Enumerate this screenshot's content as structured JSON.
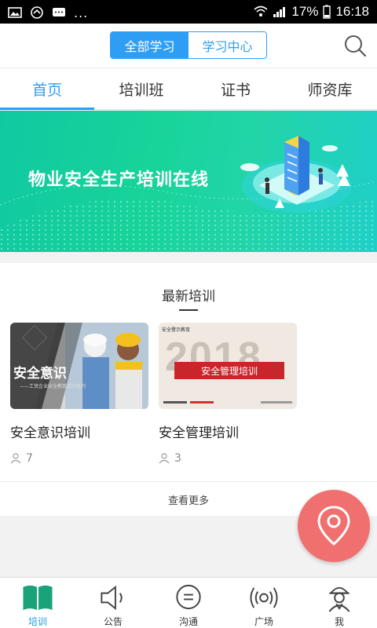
{
  "status_bar": {
    "more": "...",
    "battery_pct": "17%",
    "time": "16:18"
  },
  "header": {
    "segments": [
      {
        "label": "全部学习",
        "active": true
      },
      {
        "label": "学习中心",
        "active": false
      }
    ],
    "search_icon": "search-icon"
  },
  "tabs": [
    {
      "label": "首页",
      "active": true
    },
    {
      "label": "培训班",
      "active": false
    },
    {
      "label": "证书",
      "active": false
    },
    {
      "label": "师资库",
      "active": false
    }
  ],
  "banner": {
    "title": "物业安全生产培训在线",
    "accent": "#18d39a"
  },
  "latest": {
    "title": "最新培训",
    "cards": [
      {
        "title": "安全意识培训",
        "count": "7",
        "image_overlay": "安全意识",
        "image_caption": "——工贸企业安全教育培训系列"
      },
      {
        "title": "安全管理培训",
        "count": "3",
        "image_overlay": "安全管理培训",
        "image_year": "2018",
        "image_header": "安全警示教育"
      }
    ],
    "more_label": "查看更多"
  },
  "fab": {
    "icon": "location-pin-icon",
    "color": "#f07070"
  },
  "bottom_nav": [
    {
      "label": "培训",
      "icon": "book-icon",
      "active": true
    },
    {
      "label": "公告",
      "icon": "speaker-icon",
      "active": false
    },
    {
      "label": "沟通",
      "icon": "chat-icon",
      "active": false
    },
    {
      "label": "广场",
      "icon": "broadcast-icon",
      "active": false
    },
    {
      "label": "我",
      "icon": "worker-icon",
      "active": false
    }
  ],
  "colors": {
    "primary": "#2e9ef5",
    "nav_active": "#1e9bdc"
  }
}
